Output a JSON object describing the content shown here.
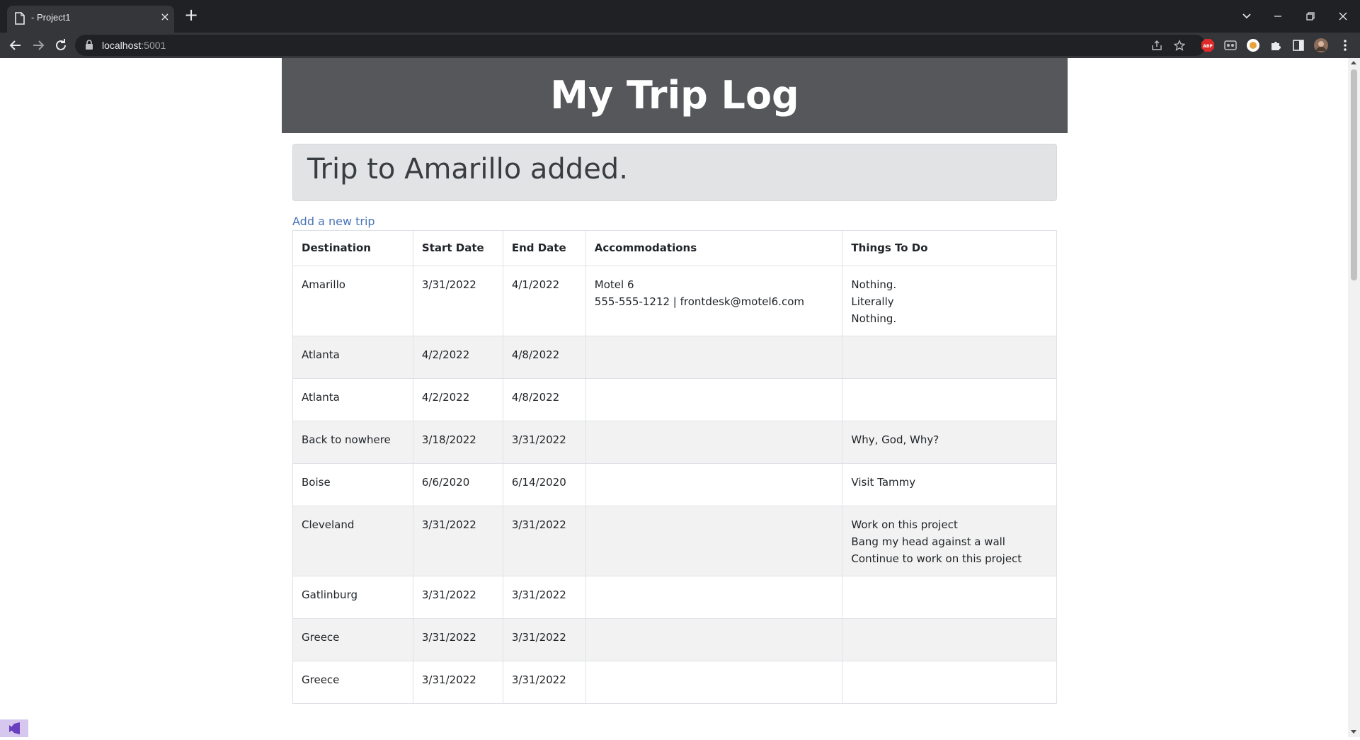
{
  "browser": {
    "tab_title": "- Project1",
    "tab_close": "×",
    "new_tab": "+",
    "url_host": "localhost",
    "url_port": ":5001"
  },
  "page": {
    "title": "My Trip Log",
    "alert_message": "Trip to Amarillo added.",
    "add_link": "Add a new trip"
  },
  "table": {
    "headers": [
      "Destination",
      "Start Date",
      "End Date",
      "Accommodations",
      "Things To Do"
    ],
    "rows": [
      {
        "destination": "Amarillo",
        "start": "3/31/2022",
        "end": "4/1/2022",
        "accommodations": "Motel 6\n555-555-1212 | frontdesk@motel6.com",
        "todo": "Nothing.\nLiterally\nNothing."
      },
      {
        "destination": "Atlanta",
        "start": "4/2/2022",
        "end": "4/8/2022",
        "accommodations": "",
        "todo": ""
      },
      {
        "destination": "Atlanta",
        "start": "4/2/2022",
        "end": "4/8/2022",
        "accommodations": "",
        "todo": ""
      },
      {
        "destination": "Back to nowhere",
        "start": "3/18/2022",
        "end": "3/31/2022",
        "accommodations": "",
        "todo": "Why, God, Why?"
      },
      {
        "destination": "Boise",
        "start": "6/6/2020",
        "end": "6/14/2020",
        "accommodations": "",
        "todo": "Visit Tammy"
      },
      {
        "destination": "Cleveland",
        "start": "3/31/2022",
        "end": "3/31/2022",
        "accommodations": "",
        "todo": "Work on this project\nBang my head against a wall\nContinue to work on this project"
      },
      {
        "destination": "Gatlinburg",
        "start": "3/31/2022",
        "end": "3/31/2022",
        "accommodations": "",
        "todo": ""
      },
      {
        "destination": "Greece",
        "start": "3/31/2022",
        "end": "3/31/2022",
        "accommodations": "",
        "todo": ""
      },
      {
        "destination": "Greece",
        "start": "3/31/2022",
        "end": "3/31/2022",
        "accommodations": "",
        "todo": ""
      }
    ]
  },
  "colors": {
    "header_bg": "#55575b",
    "alert_bg": "#e2e3e5",
    "link": "#4a74b8",
    "row_stripe": "#f2f2f2"
  },
  "icons": [
    "page-favicon-icon",
    "back-arrow-icon",
    "forward-arrow-icon",
    "reload-icon",
    "lock-icon",
    "share-icon",
    "star-icon",
    "adblock-icon",
    "reader-icon",
    "extension-icon",
    "puzzle-icon",
    "sidebar-icon",
    "profile-avatar-icon",
    "kebab-menu-icon",
    "tab-search-icon",
    "minimize-icon",
    "restore-icon",
    "close-window-icon",
    "visual-studio-icon"
  ]
}
